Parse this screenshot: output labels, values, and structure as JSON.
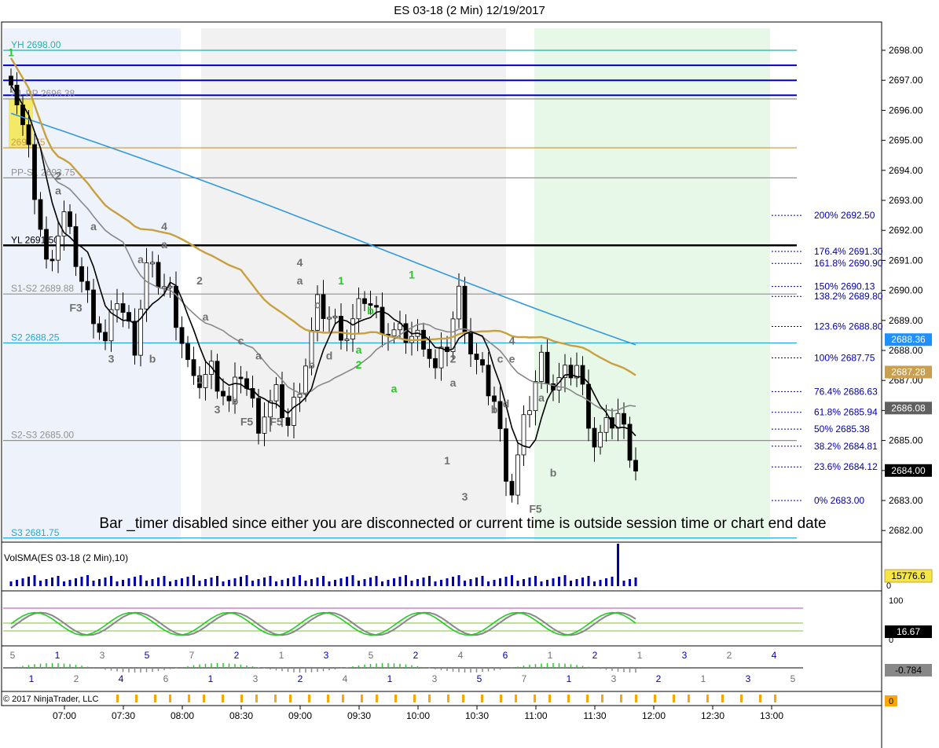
{
  "window": {
    "title": "ES 03-18 (2 Min)  12/19/2017",
    "copyright": "© 2017 NinjaTrader, LLC",
    "banner": "Bar _timer disabled since either you are disconnected or current time is outside session time or chart end date"
  },
  "chart_data": {
    "type": "candlestick",
    "title": "ES 03-18 (2 Min)  12/19/2017",
    "price_axis": {
      "ticks": [
        "2698.00",
        "2697.00",
        "2696.00",
        "2695.00",
        "2694.00",
        "2693.00",
        "2692.00",
        "2691.00",
        "2690.00",
        "2689.00",
        "2688.00",
        "2687.00",
        "2686.00",
        "2685.00",
        "2684.00",
        "2683.00",
        "2682.00"
      ],
      "ylim": [
        2681.6,
        2698.4
      ]
    },
    "time_axis": {
      "ticks": [
        "07:00",
        "07:30",
        "08:00",
        "08:30",
        "09:00",
        "09:30",
        "10:00",
        "10:30",
        "11:00",
        "11:30",
        "12:00",
        "12:30",
        "13:00"
      ]
    },
    "price_path": [
      [
        0,
        2697.2
      ],
      [
        3,
        2694.5
      ],
      [
        6,
        2690.8
      ],
      [
        9,
        2692.5
      ],
      [
        12,
        2690.3
      ],
      [
        16,
        2688.2
      ],
      [
        18,
        2689.8
      ],
      [
        21,
        2688.2
      ],
      [
        23,
        2690.8
      ],
      [
        27,
        2689.9
      ],
      [
        31,
        2686.8
      ],
      [
        34,
        2687.4
      ],
      [
        37,
        2686.2
      ],
      [
        39,
        2687.3
      ],
      [
        42,
        2685.6
      ],
      [
        45,
        2686.5
      ],
      [
        47,
        2685.5
      ],
      [
        50,
        2687.6
      ],
      [
        52,
        2689.5
      ],
      [
        57,
        2688.5
      ],
      [
        60,
        2689.8
      ],
      [
        64,
        2688.6
      ],
      [
        70,
        2688.4
      ],
      [
        72,
        2687.3
      ],
      [
        74,
        2688.2
      ],
      [
        76,
        2689.9
      ],
      [
        78,
        2688.0
      ],
      [
        82,
        2686.3
      ],
      [
        84,
        2684.0
      ],
      [
        85,
        2683.3
      ],
      [
        87,
        2685.5
      ],
      [
        90,
        2687.7
      ],
      [
        92,
        2686.8
      ],
      [
        96,
        2687.5
      ],
      [
        99,
        2684.9
      ],
      [
        103,
        2685.9
      ],
      [
        106,
        2684.1
      ]
    ],
    "levels": [
      {
        "label": "YH 2698.00",
        "price": 2698.0,
        "color": "#20b2aa"
      },
      {
        "label": "",
        "price": 2697.5,
        "color": "#0000c8"
      },
      {
        "label": "",
        "price": 2697.0,
        "color": "#0000c8"
      },
      {
        "label": "",
        "price": 2696.5,
        "color": "#0000c8"
      },
      {
        "label": "S1-PP 2696.38",
        "price": 2696.38,
        "color": "#909090"
      },
      {
        "label": "2694.75",
        "price": 2694.75,
        "color": "#c8a050"
      },
      {
        "label": "PP-S1 2693.75",
        "price": 2693.75,
        "color": "#909090"
      },
      {
        "label": "YL 2691.50",
        "price": 2691.5,
        "color": "#000000"
      },
      {
        "label": "S1-S2 2689.88",
        "price": 2689.88,
        "color": "#909090"
      },
      {
        "label": "S2 2688.25",
        "price": 2688.25,
        "color": "#20a8d8"
      },
      {
        "label": "S2-S3 2685.00",
        "price": 2685.0,
        "color": "#909090"
      },
      {
        "label": "S3 2681.75",
        "price": 2681.75,
        "color": "#20a8d8"
      }
    ],
    "fibs": [
      {
        "label": "200%",
        "price": 2692.5
      },
      {
        "label": "176.4%",
        "price": 2691.3
      },
      {
        "label": "161.8%",
        "price": 2690.9
      },
      {
        "label": "150%",
        "price": 2690.13
      },
      {
        "label": "138.2%",
        "price": 2689.8
      },
      {
        "label": "123.6%",
        "price": 2688.8
      },
      {
        "label": "100%",
        "price": 2687.75
      },
      {
        "label": "76.4%",
        "price": 2686.63
      },
      {
        "label": "61.8%",
        "price": 2685.94
      },
      {
        "label": "50%",
        "price": 2685.38
      },
      {
        "label": "38.2%",
        "price": 2684.81
      },
      {
        "label": "23.6%",
        "price": 2684.12
      },
      {
        "label": "0%",
        "price": 2683.0
      }
    ],
    "price_tags": [
      {
        "text": "2688.36",
        "price": 2688.36,
        "bg": "#1e90ff"
      },
      {
        "text": "2687.28",
        "price": 2687.28,
        "bg": "#c8a050"
      },
      {
        "text": "2686.08",
        "price": 2686.08,
        "bg": "#606060"
      },
      {
        "text": "2684.00",
        "price": 2684.0,
        "bg": "#000000"
      }
    ],
    "wave_labels": [
      {
        "t": "1",
        "bar": 0,
        "price": 2697.8,
        "c": "#22cc22"
      },
      {
        "t": "2",
        "bar": 8,
        "price": 2693.7,
        "c": "#707070"
      },
      {
        "t": "a",
        "bar": 8,
        "price": 2693.2,
        "c": "#707070"
      },
      {
        "t": "F3",
        "bar": 11,
        "price": 2689.3,
        "c": "#707070"
      },
      {
        "t": "a",
        "bar": 14,
        "price": 2692.0,
        "c": "#707070"
      },
      {
        "t": "3",
        "bar": 17,
        "price": 2687.6,
        "c": "#707070"
      },
      {
        "t": "a",
        "bar": 22,
        "price": 2690.9,
        "c": "#707070"
      },
      {
        "t": "b",
        "bar": 24,
        "price": 2687.6,
        "c": "#707070"
      },
      {
        "t": "4",
        "bar": 26,
        "price": 2692.0,
        "c": "#707070"
      },
      {
        "t": "a",
        "bar": 26,
        "price": 2691.4,
        "c": "#707070"
      },
      {
        "t": "2",
        "bar": 32,
        "price": 2690.2,
        "c": "#707070"
      },
      {
        "t": "a",
        "bar": 33,
        "price": 2689.0,
        "c": "#707070"
      },
      {
        "t": "1",
        "bar": 32,
        "price": 2686.9,
        "c": "#707070"
      },
      {
        "t": "3",
        "bar": 35,
        "price": 2685.9,
        "c": "#707070"
      },
      {
        "t": "c",
        "bar": 39,
        "price": 2688.2,
        "c": "#707070"
      },
      {
        "t": "b",
        "bar": 38,
        "price": 2686.2,
        "c": "#707070"
      },
      {
        "t": "a",
        "bar": 42,
        "price": 2687.7,
        "c": "#707070"
      },
      {
        "t": "F5",
        "bar": 40,
        "price": 2685.5,
        "c": "#707070"
      },
      {
        "t": "F5",
        "bar": 45,
        "price": 2685.5,
        "c": "#707070"
      },
      {
        "t": "4",
        "bar": 49,
        "price": 2690.8,
        "c": "#707070"
      },
      {
        "t": "a",
        "bar": 49,
        "price": 2690.2,
        "c": "#707070"
      },
      {
        "t": "c",
        "bar": 52,
        "price": 2689.4,
        "c": "#707070"
      },
      {
        "t": "b",
        "bar": 51,
        "price": 2687.4,
        "c": "#707070"
      },
      {
        "t": "d",
        "bar": 54,
        "price": 2687.7,
        "c": "#707070"
      },
      {
        "t": "1",
        "bar": 56,
        "price": 2690.2,
        "c": "#22cc22"
      },
      {
        "t": "b",
        "bar": 61,
        "price": 2689.2,
        "c": "#22cc22"
      },
      {
        "t": "a",
        "bar": 59,
        "price": 2687.9,
        "c": "#22cc22"
      },
      {
        "t": "2",
        "bar": 59,
        "price": 2687.4,
        "c": "#22cc22"
      },
      {
        "t": "a",
        "bar": 65,
        "price": 2686.6,
        "c": "#22cc22"
      },
      {
        "t": "1",
        "bar": 68,
        "price": 2690.4,
        "c": "#22cc22"
      },
      {
        "t": "2",
        "bar": 75,
        "price": 2687.6,
        "c": "#707070"
      },
      {
        "t": "a",
        "bar": 75,
        "price": 2686.8,
        "c": "#707070"
      },
      {
        "t": "1",
        "bar": 74,
        "price": 2684.2,
        "c": "#707070"
      },
      {
        "t": "3",
        "bar": 77,
        "price": 2683.0,
        "c": "#707070"
      },
      {
        "t": "4",
        "bar": 85,
        "price": 2688.2,
        "c": "#707070"
      },
      {
        "t": "c",
        "bar": 83,
        "price": 2687.6,
        "c": "#707070"
      },
      {
        "t": "e",
        "bar": 85,
        "price": 2687.6,
        "c": "#707070"
      },
      {
        "t": "b",
        "bar": 82,
        "price": 2685.9,
        "c": "#707070"
      },
      {
        "t": "d",
        "bar": 84,
        "price": 2686.1,
        "c": "#707070"
      },
      {
        "t": "a",
        "bar": 90,
        "price": 2686.3,
        "c": "#707070"
      },
      {
        "t": "b",
        "bar": 92,
        "price": 2683.8,
        "c": "#707070"
      },
      {
        "t": "F5",
        "bar": 89,
        "price": 2682.6,
        "c": "#707070"
      }
    ],
    "volume_panel": {
      "label": "VolSMA(ES 03-18 (2 Min),10)",
      "value": "15776.6",
      "ticks": [
        "0"
      ]
    },
    "stochastic_panel": {
      "ticks": [
        "100",
        "0"
      ],
      "value": "16.67"
    },
    "wave_count_panel": {
      "value": "-0.784",
      "labels_top": [
        "5",
        "1",
        "3",
        "5",
        "7",
        "2",
        "1",
        "3",
        "5",
        "2",
        "4",
        "6",
        "1",
        "2",
        "1",
        "3",
        "2",
        "4"
      ],
      "labels_bottom": [
        "1",
        "2",
        "4",
        "6",
        "1",
        "3",
        "2",
        "4",
        "1",
        "3",
        "5",
        "7",
        "1",
        "3",
        "2",
        "1",
        "3",
        "5"
      ]
    },
    "session_marker_panel": {
      "value": "0"
    }
  }
}
